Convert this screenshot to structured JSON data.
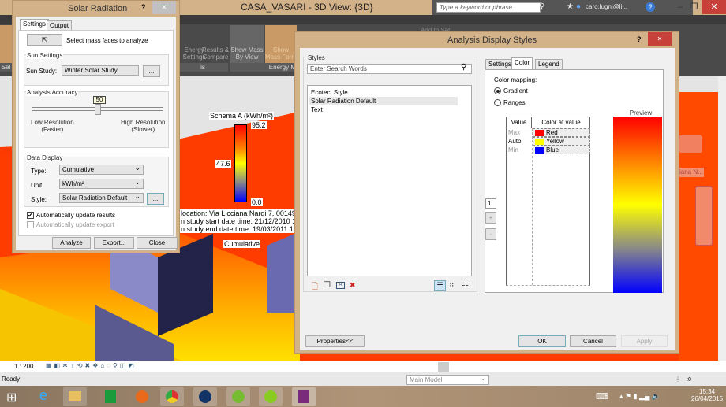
{
  "app": {
    "title": "CASA_VASARI - 3D View: {3D}",
    "search_placeholder": "Type a keyword or phrase",
    "user": "caro.lugni@li...",
    "help": "?"
  },
  "ribbon": {
    "buttons": [
      "Energy Settings",
      "Results & Compare",
      "Show Mass By View",
      "Show Mass Form"
    ],
    "panels": [
      "Sel",
      "is",
      "Energy M"
    ],
    "add_to_set": "Add to Set"
  },
  "solar_dialog": {
    "title": "Solar Radiation",
    "help": "?",
    "tabs": [
      "Settings",
      "Output"
    ],
    "select_label": "Select mass faces to analyze",
    "sun_settings": {
      "group": "Sun Settings",
      "label": "Sun Study:",
      "value": "Winter Solar Study",
      "browse": "..."
    },
    "accuracy": {
      "group": "Analysis Accuracy",
      "value": "50",
      "percent": 50,
      "low": "Low  Resolution",
      "low_sub": "(Faster)",
      "high": "High Resolution",
      "high_sub": "(Slower)"
    },
    "data_display": {
      "group": "Data Display",
      "type_label": "Type:",
      "type_value": "Cumulative",
      "unit_label": "Unit:",
      "unit_value": "kWh/m²",
      "style_label": "Style:",
      "style_value": "Solar Radiation Default",
      "browse": "..."
    },
    "auto_update_results": {
      "label": "Automatically update results",
      "checked": true
    },
    "auto_update_export": {
      "label": "Automatically update export",
      "checked": false
    },
    "buttons": {
      "analyze": "Analyze",
      "export": "Export...",
      "close": "Close"
    }
  },
  "viewport": {
    "legend_title": "Schema A (kWh/m²)",
    "max": "95.2",
    "mid": "47.6",
    "min": "0.0",
    "info": [
      "location: Via Licciana Nardi 7, 00149 I",
      "n study start date time: 21/12/2010 10.",
      "n study end date time: 19/03/2011 16.0"
    ],
    "mode": "Cumulative",
    "nav_label": "iana N..."
  },
  "styles_dialog": {
    "title": "Analysis Display Styles",
    "help": "?",
    "styles_group": "Styles",
    "search_placeholder": "Enter Search Words",
    "styles": [
      "Ecotect Style",
      "Solar Radiation Default",
      "Text"
    ],
    "selected_style": "Solar Radiation Default",
    "tabs": [
      "Settings",
      "Color",
      "Legend"
    ],
    "active_tab": "Color",
    "color_mapping": "Color mapping:",
    "gradient": "Gradient",
    "ranges": "Ranges",
    "mapping_selected": "Gradient",
    "table_headers": [
      "Value",
      "Color at value"
    ],
    "rows": [
      {
        "value": "Max",
        "color": "Red",
        "hex": "#ff0000"
      },
      {
        "value": "Auto",
        "color": "Yellow",
        "hex": "#ffff00"
      },
      {
        "value": "Min",
        "color": "Blue",
        "hex": "#0000ff"
      }
    ],
    "count": "1",
    "plus": "+",
    "minus": "-",
    "preview": "Preview",
    "buttons": {
      "properties": "Properties<<",
      "ok": "OK",
      "cancel": "Cancel",
      "apply": "Apply"
    }
  },
  "view_control": {
    "scale": "1 : 200"
  },
  "status": {
    "text": "Ready",
    "model": "Main Model",
    "filter_count": ":0"
  },
  "taskbar": {
    "time": "15:34",
    "date": "26/04/2015"
  }
}
